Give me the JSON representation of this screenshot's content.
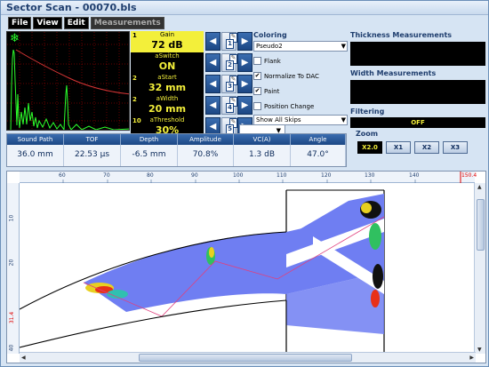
{
  "window": {
    "title": "Sector Scan - 00070.bls"
  },
  "menu": [
    {
      "label": "File"
    },
    {
      "label": "View"
    },
    {
      "label": "Edit"
    },
    {
      "label": "Measurements"
    }
  ],
  "ascan": {
    "icon": "snowflake-icon"
  },
  "params": [
    {
      "num": "1",
      "label": "Gain",
      "value": "72 dB",
      "slot": "1",
      "selected": true
    },
    {
      "num": "",
      "label": "aSwitch",
      "value": "ON",
      "slot": "2",
      "selected": false
    },
    {
      "num": "2",
      "label": "aStart",
      "value": "32 mm",
      "slot": "3",
      "selected": false
    },
    {
      "num": "2",
      "label": "aWidth",
      "value": "20 mm",
      "slot": "4",
      "selected": false
    },
    {
      "num": "10",
      "label": "aThreshold",
      "value": "30%",
      "slot": "5",
      "selected": false
    }
  ],
  "coloring": {
    "title": "Coloring",
    "palette": "Pseudo2",
    "options": [
      {
        "label": "Flank",
        "checked": false
      },
      {
        "label": "Normalize To DAC",
        "checked": true
      },
      {
        "label": "Paint",
        "checked": true
      },
      {
        "label": "Position Change",
        "checked": false
      }
    ],
    "skips": "Show All Skips"
  },
  "right": {
    "thickness_title": "Thickness Measurements",
    "width_title": "Width Measurements",
    "filtering_title": "Filtering",
    "filtering_value": "OFF"
  },
  "readouts": [
    {
      "header": "Sound Path",
      "value": "36.0 mm"
    },
    {
      "header": "TOF",
      "value": "22.53 µs"
    },
    {
      "header": "Depth",
      "value": "-6.5 mm"
    },
    {
      "header": "Amplitude",
      "value": "70.8%"
    },
    {
      "header": "VC(A)",
      "value": "1.3 dB"
    },
    {
      "header": "Angle",
      "value": "47.0°"
    }
  ],
  "zoom": {
    "title": "Zoom",
    "buttons": [
      {
        "label": "X2.0",
        "active": true
      },
      {
        "label": "X1",
        "active": false
      },
      {
        "label": "X2",
        "active": false
      },
      {
        "label": "X3",
        "active": false
      }
    ]
  },
  "view": {
    "h_ticks": [
      "60",
      "70",
      "80",
      "90",
      "100",
      "110",
      "120",
      "130",
      "140"
    ],
    "h_cursor": "150.4",
    "v_ticks": [
      "10",
      "20",
      "40"
    ],
    "v_cursor": "31.4"
  },
  "colors": {
    "accent": "#f3ef3a",
    "panel_blue": "#1c4784",
    "scan_blue": "#6f7ef2",
    "cursor_red": "#e00000"
  }
}
